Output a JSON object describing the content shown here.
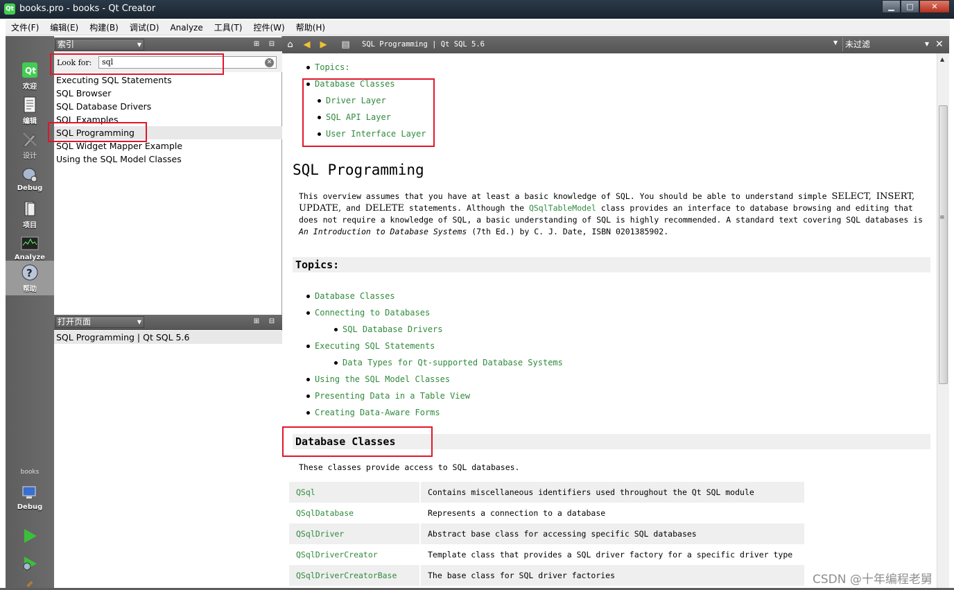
{
  "window": {
    "title": "books.pro - books - Qt Creator",
    "app_icon": "Qt",
    "controls": {
      "minimize": "▁",
      "maximize": "□",
      "close": "✕"
    }
  },
  "menu": [
    "文件(F)",
    "编辑(E)",
    "构建(B)",
    "调试(D)",
    "Analyze",
    "工具(T)",
    "控件(W)",
    "帮助(H)"
  ],
  "modes": [
    {
      "label": "欢迎",
      "icon": "qt-logo-icon"
    },
    {
      "label": "编辑",
      "icon": "document-edit-icon"
    },
    {
      "label": "设计",
      "icon": "design-pen-icon"
    },
    {
      "label": "Debug",
      "icon": "debug-bug-icon"
    },
    {
      "label": "项目",
      "icon": "project-wrench-icon"
    },
    {
      "label": "Analyze",
      "icon": "analyze-monitor-icon"
    },
    {
      "label": "帮助",
      "icon": "help-question-icon"
    }
  ],
  "kit": {
    "project": "books",
    "config": "Debug"
  },
  "left_panel": {
    "index_combo": "索引",
    "look_for_label": "Look for:",
    "search_value": "sql",
    "index_items": [
      "Executing SQL Statements",
      "SQL Browser",
      "SQL Database Drivers",
      "SQL Examples",
      "SQL Programming",
      "SQL Widget Mapper Example",
      "Using the SQL Model Classes"
    ],
    "selected_index": "SQL Programming",
    "open_pages_combo": "打开页面",
    "open_pages": [
      "SQL Programming | Qt SQL 5.6"
    ]
  },
  "doc_header": {
    "title": "SQL Programming | Qt SQL 5.6",
    "filter": "未过滤"
  },
  "content": {
    "top_topics": [
      "Topics:",
      "Database Classes",
      "Driver Layer",
      "SQL API Layer",
      "User Interface Layer"
    ],
    "heading": "SQL Programming",
    "para": {
      "p1": "This overview assumes that you have at least a basic knowledge of SQL. You should be able to understand simple ",
      "kw1": "SELECT,",
      "kw2": "INSERT,",
      "kw3": "UPDATE,",
      "mid1": " and ",
      "kw4": "DELETE",
      "p2": " statements. Although the ",
      "link": "QSqlTableModel",
      "p3": " class provides an interface to database browsing and editing that does not require a knowledge of SQL, a basic understanding of SQL is highly recommended. A standard text covering SQL databases is ",
      "italic": "An Introduction to Database Systems",
      "p4": " (7th Ed.) by C. J. Date, ISBN 0201385902."
    },
    "topics_heading": "Topics:",
    "topics": [
      {
        "text": "Database Classes",
        "level": 1
      },
      {
        "text": "Connecting to Databases",
        "level": 1
      },
      {
        "text": "SQL Database Drivers",
        "level": 2
      },
      {
        "text": "Executing SQL Statements",
        "level": 1
      },
      {
        "text": "Data Types for Qt-supported Database Systems",
        "level": 2
      },
      {
        "text": "Using the SQL Model Classes",
        "level": 1
      },
      {
        "text": "Presenting Data in a Table View",
        "level": 1
      },
      {
        "text": "Creating Data-Aware Forms",
        "level": 1
      }
    ],
    "db_heading": "Database Classes",
    "db_para": "These classes provide access to SQL databases.",
    "classes": [
      {
        "name": "QSql",
        "desc": "Contains miscellaneous identifiers used throughout the Qt SQL module"
      },
      {
        "name": "QSqlDatabase",
        "desc": "Represents a connection to a database"
      },
      {
        "name": "QSqlDriver",
        "desc": "Abstract base class for accessing specific SQL databases"
      },
      {
        "name": "QSqlDriverCreator",
        "desc": "Template class that provides a SQL driver factory for a specific driver type"
      },
      {
        "name": "QSqlDriverCreatorBase",
        "desc": "The base class for SQL driver factories"
      }
    ]
  },
  "watermark": "CSDN @十年编程老舅",
  "colors": {
    "link": "#2f8a3d",
    "highlight_box": "#e0162b",
    "sidebar": "#5e5e5e"
  }
}
